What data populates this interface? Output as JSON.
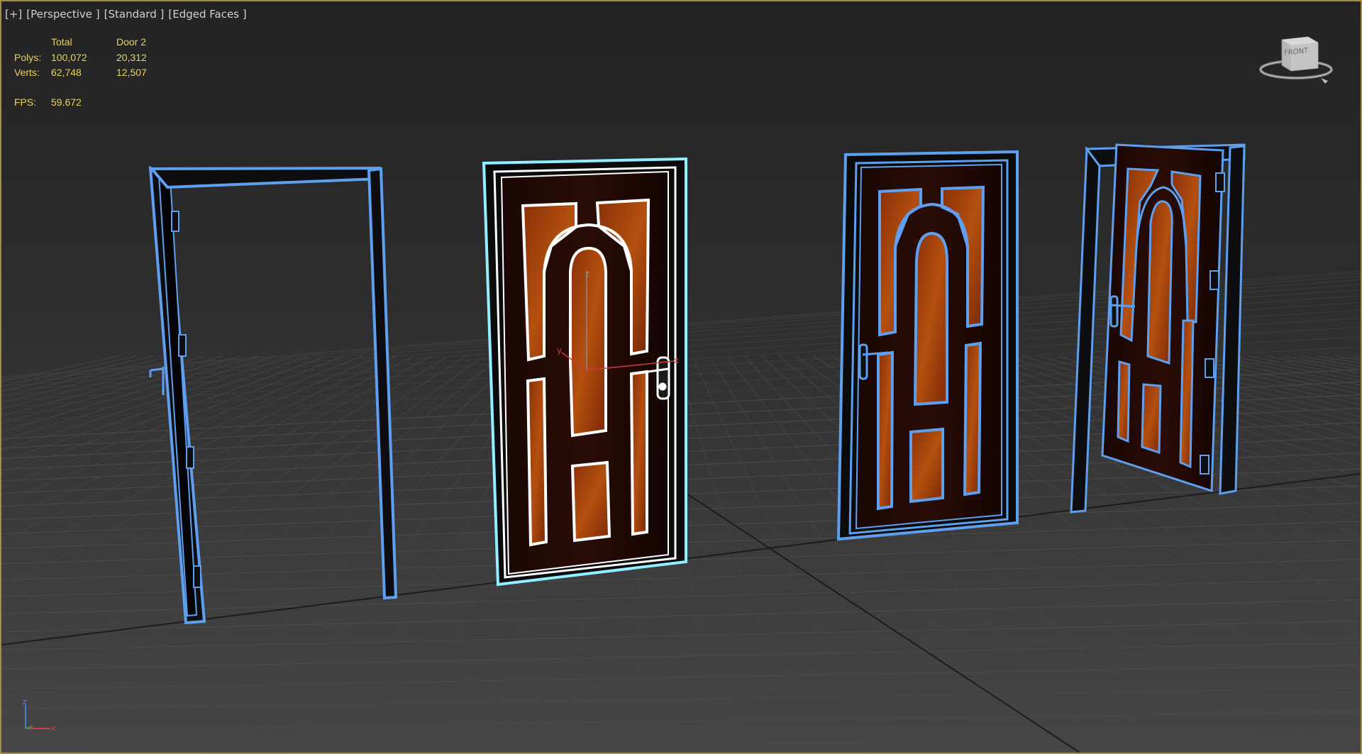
{
  "viewport": {
    "labels": [
      "[+]",
      "[Perspective ]",
      "[Standard ]",
      "[Edged Faces ]"
    ]
  },
  "stats": {
    "header_total": "Total",
    "header_selected": "Door 2",
    "polys_label": "Polys:",
    "polys_total": "100,072",
    "polys_selected": "20,312",
    "verts_label": "Verts:",
    "verts_total": "62,748",
    "verts_selected": "12,507",
    "fps_label": "FPS:",
    "fps_value": "59.672"
  },
  "viewcube": {
    "label": "FRONT"
  },
  "axis": {
    "z": "z",
    "x": "x"
  },
  "gizmo": {
    "z": "z",
    "y": "y",
    "x": "x"
  },
  "colors": {
    "viewport_border": "#a48f3c",
    "stats_text": "#e7d35f",
    "wireframe": "#5e9ff0",
    "selection": "#8ff0ff",
    "wood": "#a9430a",
    "door_dark": "#170604",
    "grid_line": "#4a4a4a",
    "axis_line": "#1b1b1b"
  },
  "scene_objects": [
    "door-frame-open",
    "door-2-selected",
    "door-3",
    "door-4-open"
  ]
}
